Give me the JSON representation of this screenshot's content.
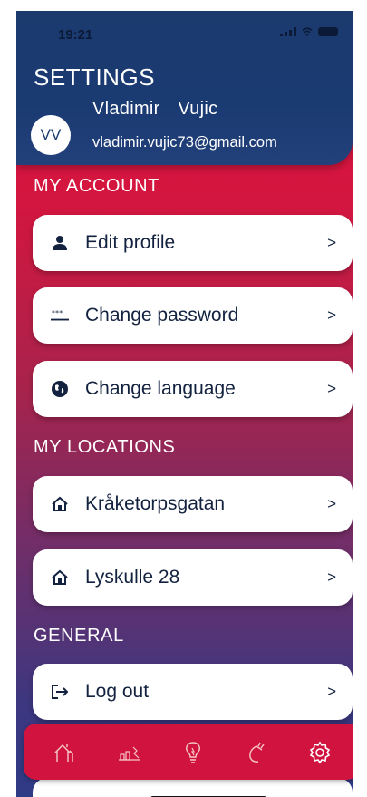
{
  "status_bar": {
    "time": "19:21"
  },
  "header": {
    "title": "SETTINGS",
    "avatar_initials": "VV",
    "user_name": "Vladimir  Vujic",
    "user_email": "vladimir.vujic73@gmail.com"
  },
  "sections": {
    "my_account": "MY ACCOUNT",
    "my_locations": "MY LOCATIONS",
    "general": "GENERAL"
  },
  "account_items": [
    {
      "label": "Edit profile",
      "icon": "person-icon"
    },
    {
      "label": "Change password",
      "icon": "password-icon"
    },
    {
      "label": "Change language",
      "icon": "globe-icon"
    }
  ],
  "location_items": [
    {
      "label": "Kråketorpsgatan",
      "icon": "home-icon"
    },
    {
      "label": "Lyskulle 28",
      "icon": "home-icon"
    }
  ],
  "general_items": [
    {
      "label": "Log out",
      "icon": "logout-icon"
    }
  ],
  "chevron": ">",
  "tab_bar": {
    "tabs": [
      "home-icon",
      "energy-chart-icon",
      "lightbulb-icon",
      "plug-icon",
      "gear-icon"
    ],
    "active": "gear-icon"
  },
  "colors": {
    "header_navy": "#1b3a6e",
    "accent_red": "#d11340",
    "card_text": "#13223f"
  }
}
